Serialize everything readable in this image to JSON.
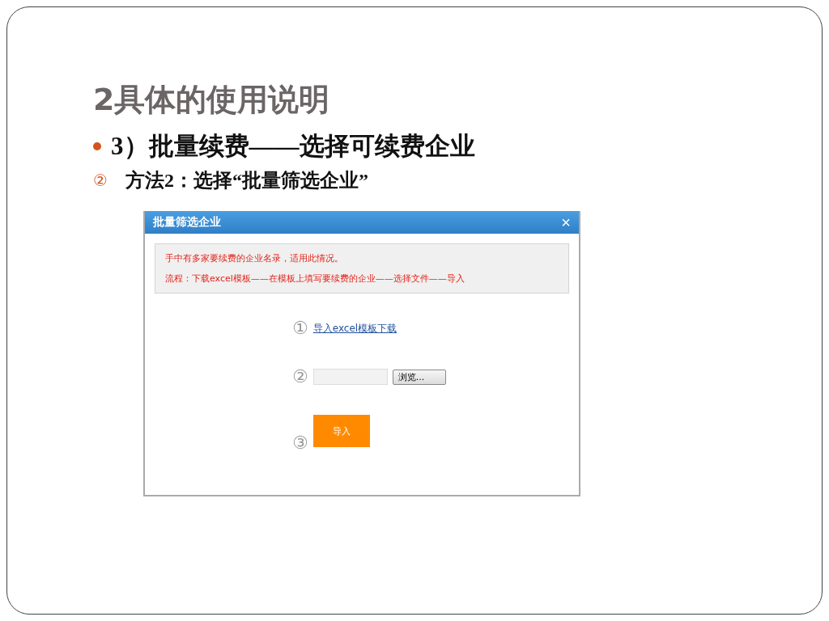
{
  "slide": {
    "title": "2具体的使用说明",
    "bullet": "3）批量续费——选择可续费企业",
    "sub_marker": "②",
    "sub_text": "方法2：选择“批量筛选企业”"
  },
  "dialog": {
    "title": "批量筛选企业",
    "close": "×",
    "notice": [
      "手中有多家要续费的企业名录，适用此情况。",
      "流程：下载excel模板——在模板上填写要续费的企业——选择文件——导入"
    ],
    "steps": [
      {
        "kind": "link",
        "number": "①",
        "label": "导入excel模板下载"
      },
      {
        "kind": "file",
        "number": "②",
        "label": "浏览..."
      },
      {
        "kind": "button",
        "number": "③",
        "label": "导入"
      }
    ]
  }
}
